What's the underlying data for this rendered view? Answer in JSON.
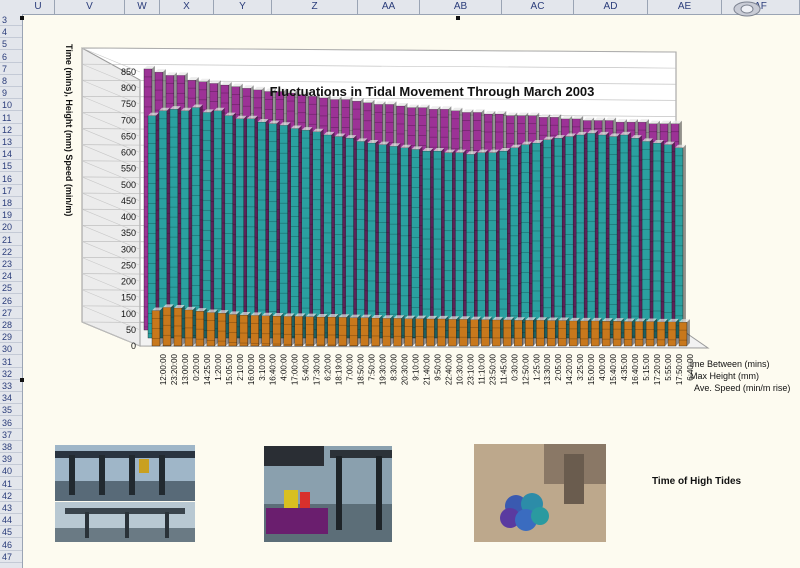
{
  "columns": [
    "U",
    "V",
    "W",
    "X",
    "Y",
    "Z",
    "AA",
    "AB",
    "AC",
    "AD",
    "AE",
    "AF"
  ],
  "rows": [
    "3",
    "4",
    "5",
    "6",
    "7",
    "8",
    "9",
    "10",
    "11",
    "12",
    "13",
    "14",
    "15",
    "16",
    "17",
    "18",
    "19",
    "20",
    "21",
    "22",
    "23",
    "24",
    "25",
    "26",
    "27",
    "28",
    "29",
    "30",
    "31",
    "32",
    "33",
    "34",
    "35",
    "36",
    "37",
    "38",
    "39",
    "40",
    "41",
    "42",
    "43",
    "44",
    "45",
    "46",
    "47"
  ],
  "caption": "Time of High Tides",
  "chart_data": {
    "type": "bar",
    "title": "Fluctuations in Tidal Movement Through March 2003",
    "ylabel": "Time (mins), Height (mm) Speed (min/m)",
    "ylim": [
      0,
      850
    ],
    "yticks": [
      0,
      50,
      100,
      150,
      200,
      250,
      300,
      350,
      400,
      450,
      500,
      550,
      600,
      650,
      700,
      750,
      800,
      850
    ],
    "categories": [
      "12:00:00",
      "23:20:00",
      "13:00:00",
      "0:20:00",
      "14:25:00",
      "1:20:00",
      "15:05:00",
      "2:10:00",
      "16:00:00",
      "3:10:00",
      "16:40:00",
      "4:00:00",
      "17:00:00",
      "5:40:00",
      "17:30:00",
      "6:20:00",
      "18:19:00",
      "7:00:00",
      "18:50:00",
      "7:50:00",
      "19:30:00",
      "8:30:00",
      "20:30:00",
      "9:10:00",
      "21:40:00",
      "9:50:00",
      "22:40:00",
      "10:30:00",
      "23:10:00",
      "11:10:00",
      "23:50:00",
      "11:45:00",
      "0:30:00",
      "12:50:00",
      "1:25:00",
      "13:30:00",
      "2:05:00",
      "14:20:00",
      "3:25:00",
      "15:00:00",
      "4:00:00",
      "15:40:00",
      "4:35:00",
      "16:40:00",
      "5:15:00",
      "17:20:00",
      "5:55:00",
      "17:50:00",
      "6:40:00"
    ],
    "series": [
      {
        "name": "Ave. Speed (min/m rise)",
        "values": [
          110,
          120,
          118,
          112,
          108,
          104,
          102,
          98,
          96,
          95,
          94,
          93,
          92,
          92,
          91,
          90,
          90,
          89,
          88,
          88,
          87,
          86,
          86,
          85,
          85,
          84,
          84,
          83,
          83,
          82,
          82,
          81,
          81,
          80,
          80,
          80,
          79,
          79,
          78,
          78,
          78,
          77,
          77,
          76,
          76,
          76,
          75,
          75,
          74
        ],
        "color": "#c8781c"
      },
      {
        "name": "Max Height (mm)",
        "values": [
          690,
          705,
          710,
          705,
          715,
          700,
          705,
          690,
          680,
          680,
          670,
          665,
          660,
          650,
          645,
          640,
          630,
          625,
          620,
          610,
          605,
          600,
          595,
          590,
          585,
          580,
          580,
          575,
          575,
          570,
          575,
          575,
          580,
          590,
          600,
          605,
          615,
          620,
          625,
          630,
          635,
          630,
          625,
          630,
          620,
          610,
          605,
          600,
          590
        ],
        "color": "#2aa0a0"
      },
      {
        "name": "ime Between (mins)",
        "values": [
          810,
          800,
          790,
          790,
          775,
          770,
          765,
          760,
          755,
          750,
          745,
          740,
          740,
          735,
          730,
          725,
          720,
          715,
          715,
          710,
          705,
          700,
          700,
          695,
          690,
          690,
          685,
          685,
          680,
          675,
          675,
          670,
          670,
          665,
          665,
          665,
          660,
          660,
          655,
          655,
          650,
          650,
          650,
          645,
          645,
          645,
          640,
          640,
          640
        ],
        "color": "#9c3296"
      }
    ],
    "grid": true,
    "legend": "right"
  }
}
